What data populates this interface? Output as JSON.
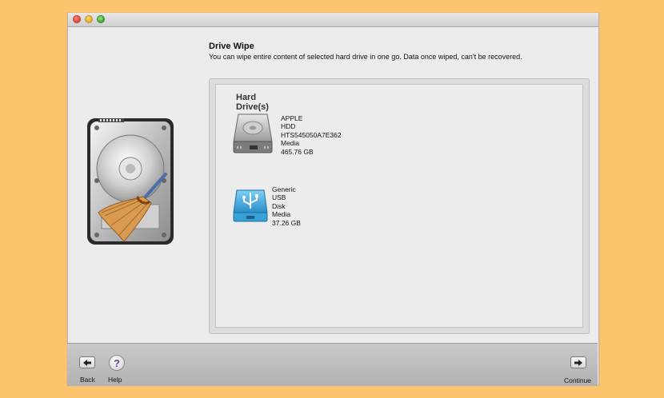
{
  "window": {
    "controls": [
      "close",
      "minimize",
      "zoom"
    ]
  },
  "header": {
    "title": "Drive Wipe",
    "description": "You can wipe entire content of selected hard drive in one go. Data once wiped, can't be recovered."
  },
  "drives": {
    "title": "Hard Drive(s)",
    "items": [
      {
        "icon": "hard-drive-icon",
        "lines": [
          "APPLE",
          "HDD",
          "HTS545050A7E362",
          "Media",
          "465.76 GB"
        ]
      },
      {
        "icon": "usb-drive-icon",
        "lines": [
          "Generic",
          "USB",
          "Disk",
          "Media",
          "37.26 GB"
        ]
      }
    ]
  },
  "footer": {
    "back_label": "Back",
    "help_label": "Help",
    "help_glyph": "?",
    "continue_label": "Continue"
  },
  "colors": {
    "background": "#fdc46e",
    "window": "#ececec",
    "help_accent": "#6a3ea1"
  }
}
